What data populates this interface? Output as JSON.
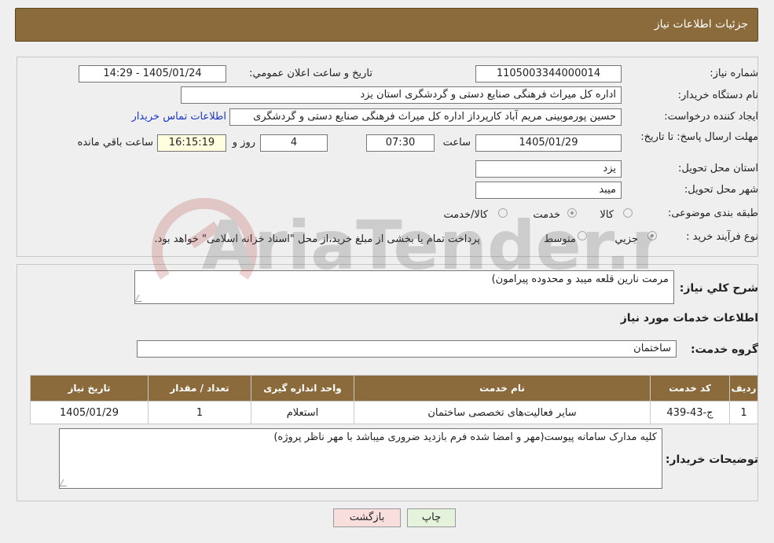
{
  "header": {
    "title": "جزئیات اطلاعات نیاز"
  },
  "form": {
    "need_number_label": "شماره نیاز:",
    "need_number": "1105003344000014",
    "announce_label": "تاریخ و ساعت اعلان عمومي:",
    "announce_value": "1405/01/24 - 14:29",
    "buyer_org_label": "نام دستگاه خريدار:",
    "buyer_org": "اداره کل میراث فرهنگی  صنایع دستی و گردشگری استان یزد",
    "creator_label": "ايجاد کننده درخواست:",
    "creator": "حسین پورموبینی مریم آباد کارپرداز اداره کل میراث فرهنگی  صنایع دستی و گردشگری",
    "contact_link": "اطلاعات تماس خریدار",
    "deadline_label": "مهلت ارسال پاسخ: تا تاریخ:",
    "deadline_date": "1405/01/29",
    "time_label": "ساعت",
    "deadline_time": "07:30",
    "days_value": "4",
    "days_label": "روز و",
    "remaining_time": "16:15:19",
    "remaining_label": "ساعت باقي مانده",
    "province_label": "استان محل تحویل:",
    "province": "یزد",
    "city_label": "شهر محل تحویل:",
    "city": "میبد",
    "category_label": "طبقه بندی موضوعی:",
    "category_options": [
      "کالا",
      "خدمت",
      "کالا/خدمت"
    ],
    "category_selected": "خدمت",
    "process_label": "نوع فرآیند خرید :",
    "process_options": [
      "جزیي",
      "متوسط"
    ],
    "process_note": "پرداخت تمام یا بخشی از مبلغ خرید،از محل \"اسناد خزانه اسلامی\" خواهد بود."
  },
  "details": {
    "summary_label": "شرح کلي نياز:",
    "summary": "مرمت نارین قلعه میبد و محدوده پیرامون)",
    "services_heading": "اطلاعات خدمات مورد نياز",
    "service_group_label": "گروه خدمت:",
    "service_group": "ساختمان",
    "table": {
      "headers": [
        "رديف",
        "کد خدمت",
        "نام خدمت",
        "واحد اندازه گيری",
        "تعداد / مقدار",
        "تاريخ نياز"
      ],
      "rows": [
        [
          "1",
          "ج-43-439",
          "سایر فعالیت‌های تخصصی ساختمان",
          "استعلام",
          "1",
          "1405/01/29"
        ]
      ]
    },
    "buyer_notes_label": "توضيحات خريدار:",
    "buyer_notes": "کلیه مدارک سامانه پیوست(مهر و امضا شده فرم بازدید ضروری میباشد با مهر ناظر پروژه)"
  },
  "buttons": {
    "print": "چاپ",
    "back": "بازگشت"
  },
  "watermark": "AriaTender.net",
  "colors": {
    "header_bg": "#8b6a3c",
    "link": "#1a37c5",
    "back_btn_bg": "#f9dede",
    "print_btn_bg": "#e6f3dc"
  }
}
